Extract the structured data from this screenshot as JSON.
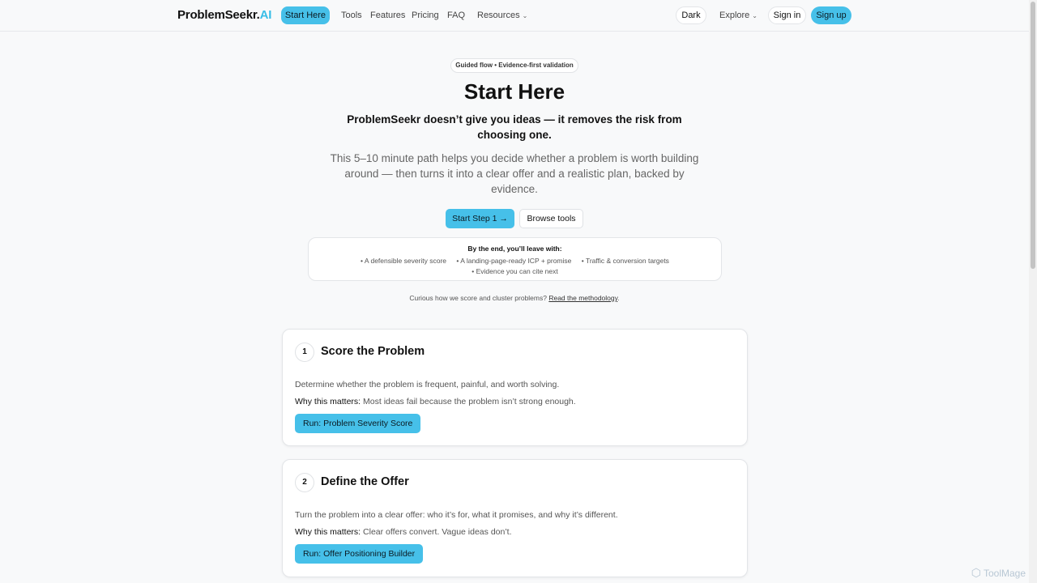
{
  "nav": {
    "logo_main": "ProblemSeekr.",
    "logo_ai": "AI",
    "start_here": "Start Here",
    "tools": "Tools",
    "features": "Features",
    "pricing": "Pricing",
    "faq": "FAQ",
    "resources": "Resources",
    "dark": "Dark",
    "explore": "Explore",
    "sign_in": "Sign in",
    "sign_up": "Sign up"
  },
  "hero": {
    "badge": "Guided flow • Evidence-first validation",
    "title": "Start Here",
    "subtitle": "ProblemSeekr doesn’t give you ideas — it removes the risk from choosing one.",
    "description": "This 5–10 minute path helps you decide whether a problem is worth building around — then turns it into a clear offer and a realistic plan, backed by evidence.",
    "cta_primary": "Start Step 1 →",
    "cta_secondary": "Browse tools"
  },
  "outcomes": {
    "title": "By the end, you’ll leave with:",
    "items": [
      "• A defensible severity score",
      "• A landing-page-ready ICP + promise",
      "• Traffic & conversion targets",
      "• Evidence you can cite next"
    ]
  },
  "methodology": {
    "text": "Curious how we score and cluster problems?",
    "link": "Read the methodology",
    "suffix": "."
  },
  "steps": [
    {
      "number": "1",
      "title": "Score the Problem",
      "description": "Determine whether the problem is frequent, painful, and worth solving.",
      "why_label": "Why this matters:",
      "why_text": "Most ideas fail because the problem isn’t strong enough.",
      "button": "Run: Problem Severity Score"
    },
    {
      "number": "2",
      "title": "Define the Offer",
      "description": "Turn the problem into a clear offer: who it’s for, what it promises, and why it’s different.",
      "why_label": "Why this matters:",
      "why_text": "Clear offers convert. Vague ideas don’t.",
      "button": "Run: Offer Positioning Builder"
    }
  ],
  "watermark": "ToolMage",
  "colors": {
    "accent": "#46c0e9",
    "logo_ai": "#38bde6",
    "background": "#f8f9fa"
  }
}
